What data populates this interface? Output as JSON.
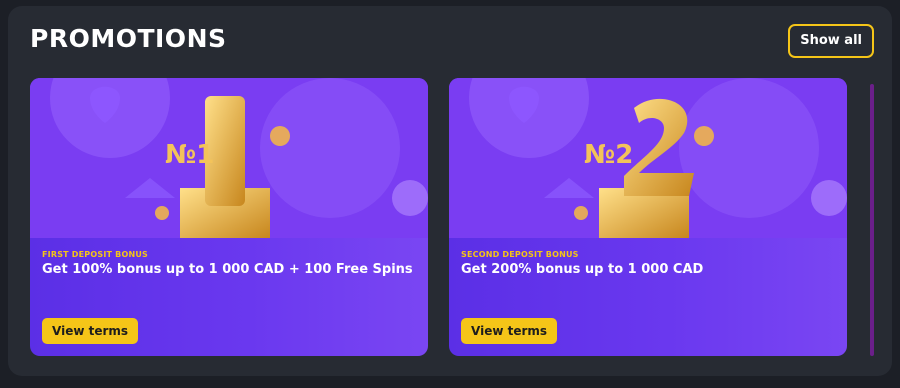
{
  "section": {
    "title": "PROMOTIONS",
    "show_all_label": "Show all"
  },
  "promotions": [
    {
      "label": "FIRST DEPOSIT BONUS",
      "headline": "Get 100% bonus up to 1 000 CAD + 100 Free Spins",
      "button_label": "View terms",
      "badge": "№1"
    },
    {
      "label": "SECOND DEPOSIT BONUS",
      "headline": "Get 200% bonus up to 1 000 CAD",
      "button_label": "View terms",
      "badge": "№2"
    }
  ],
  "colors": {
    "accent": "#f5c518",
    "card": "#6a38ef",
    "panel": "#272b33"
  }
}
